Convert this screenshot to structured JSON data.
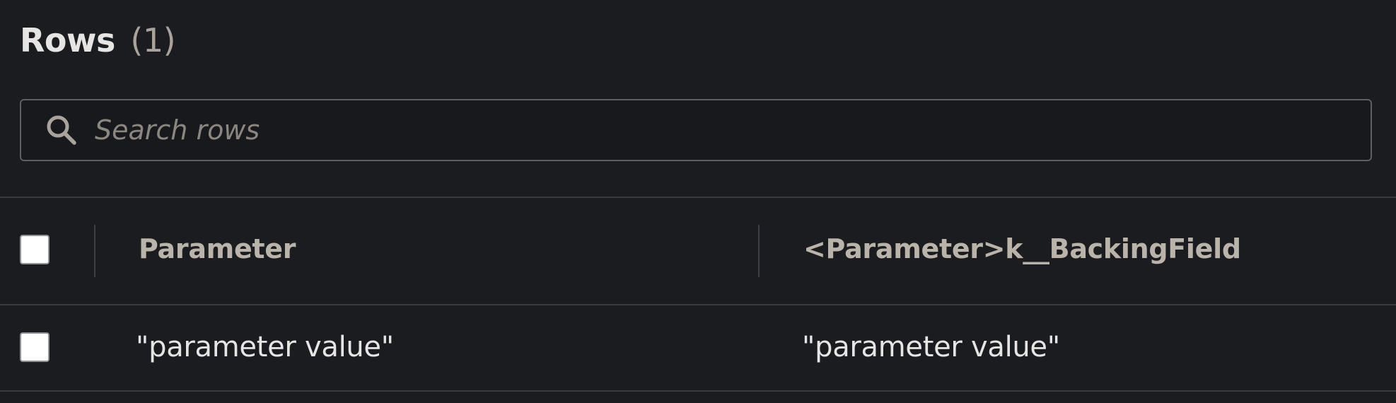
{
  "header": {
    "title": "Rows",
    "count": "(1)"
  },
  "search": {
    "placeholder": "Search rows",
    "value": "",
    "icon": "search-icon"
  },
  "table": {
    "columns": [
      "Parameter",
      "<Parameter>k__BackingField"
    ],
    "rows": [
      [
        "\"parameter value\"",
        "\"parameter value\""
      ]
    ],
    "select_all_checked": false,
    "row_checked": [
      false
    ]
  },
  "colors": {
    "background": "#1b1c1f",
    "border": "#5c5f66",
    "header_text": "#b9b3aa",
    "body_text": "#e6e5e3"
  }
}
